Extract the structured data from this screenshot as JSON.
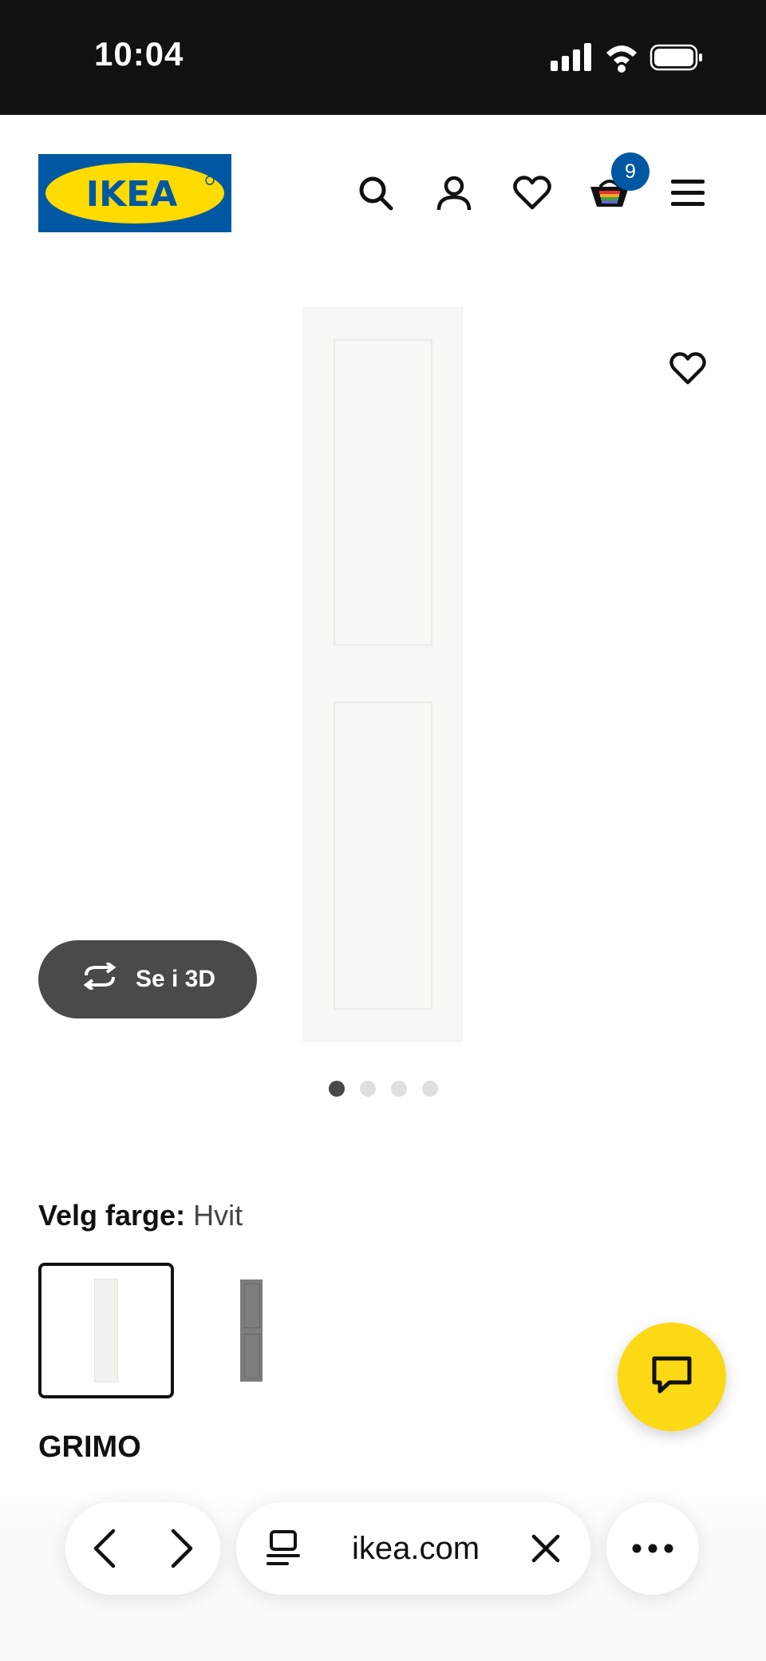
{
  "status_bar": {
    "time": "10:04"
  },
  "header": {
    "logo_text": "IKEA",
    "cart_count": "9",
    "colors": {
      "brand_blue": "#0058a3",
      "brand_yellow": "#ffdb00"
    }
  },
  "gallery": {
    "view_3d_label": "Se i 3D",
    "dots_total": 4,
    "active_index": 0
  },
  "color_select": {
    "label": "Velg farge:",
    "value": "Hvit",
    "swatches": [
      {
        "name": "Hvit",
        "color": "#f4f4f0",
        "selected": true
      },
      {
        "name": "Grå",
        "color": "#7d7d7d",
        "selected": false
      }
    ]
  },
  "product": {
    "name": "GRIMO"
  },
  "chat": {
    "color": "#fbd914"
  },
  "browser": {
    "url": "ikea.com"
  }
}
